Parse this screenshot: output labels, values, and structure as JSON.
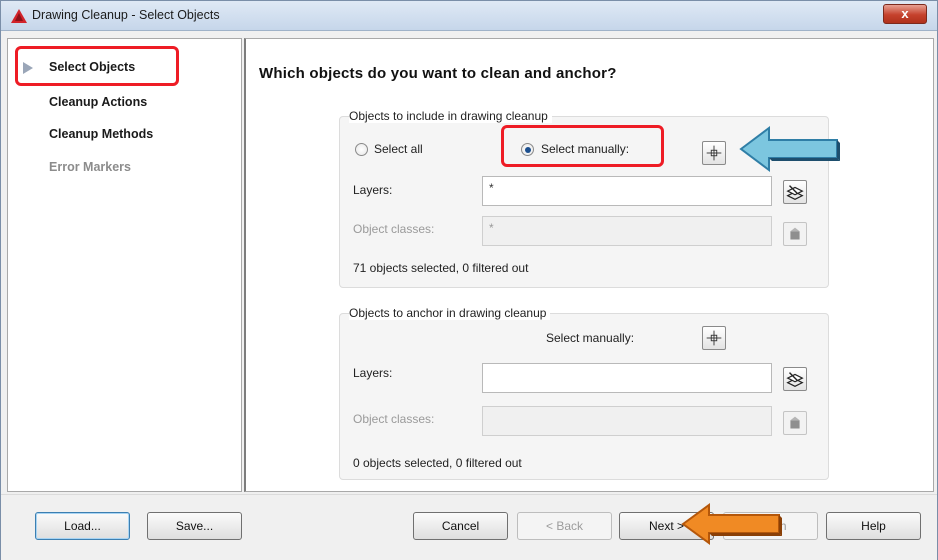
{
  "window": {
    "title": "Drawing Cleanup - Select Objects",
    "close_label": "x"
  },
  "nav": {
    "items": [
      {
        "label": "Select Objects",
        "active": true
      },
      {
        "label": "Cleanup Actions",
        "active": false
      },
      {
        "label": "Cleanup Methods",
        "active": false
      },
      {
        "label": "Error Markers",
        "enabled": false
      }
    ]
  },
  "main": {
    "heading": "Which objects do you want to clean and anchor?",
    "include_group": {
      "title": "Objects to include in drawing cleanup",
      "select_all_label": "Select all",
      "select_manually_label": "Select manually:",
      "selected_option": "Select manually:",
      "layers_label": "Layers:",
      "layers_value": "*",
      "object_classes_label": "Object classes:",
      "object_classes_value": "*",
      "status": "71 objects selected, 0 filtered out"
    },
    "anchor_group": {
      "title": "Objects to anchor in drawing cleanup",
      "select_manually_label": "Select manually:",
      "layers_label": "Layers:",
      "layers_value": "",
      "object_classes_label": "Object classes:",
      "object_classes_value": "",
      "status": "0 objects selected, 0 filtered out"
    }
  },
  "footer": {
    "load_label": "Load...",
    "save_label": "Save...",
    "cancel_label": "Cancel",
    "back_label": "< Back",
    "next_label": "Next >",
    "finish_label": "Finish",
    "help_label": "Help"
  },
  "colors": {
    "highlight_red": "#ee1c25",
    "callout_blue": "#7cc6df",
    "callout_orange": "#f08a24"
  },
  "icons": {
    "app": "autocad-logo-icon",
    "pick": "crosshair-pick-icon",
    "layer": "layer-select-icon",
    "object_class": "object-class-icon",
    "arrow": "callout-arrow-icon"
  }
}
